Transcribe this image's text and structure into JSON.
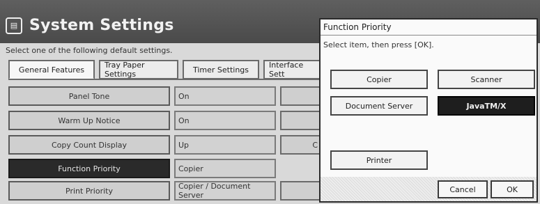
{
  "header": {
    "title": "System Settings",
    "icon": "settings-panel-icon"
  },
  "instruction": "Select one of the following default settings.",
  "tabs": [
    {
      "label": "General Features",
      "active": true
    },
    {
      "label": "Tray Paper Settings",
      "active": false
    },
    {
      "label": "Timer Settings",
      "active": false
    },
    {
      "label": "Interface Sett",
      "active": false
    }
  ],
  "settings": [
    {
      "label": "Panel Tone",
      "value": "On",
      "extra": "",
      "selected": false
    },
    {
      "label": "Warm Up Notice",
      "value": "On",
      "extra": "",
      "selected": false
    },
    {
      "label": "Copy Count Display",
      "value": "Up",
      "extra": "C",
      "selected": false
    },
    {
      "label": "Function Priority",
      "value": "Copier",
      "extra": "",
      "selected": true
    },
    {
      "label": "Print Priority",
      "value": "Copier / Document Server",
      "extra": "",
      "selected": false
    }
  ],
  "dialog": {
    "title": "Function Priority",
    "instruction": "Select item, then press [OK].",
    "options": [
      {
        "label": "Copier",
        "selected": false
      },
      {
        "label": "Scanner",
        "selected": false
      },
      {
        "label": "Document Server",
        "selected": false
      },
      {
        "label": "JavaTM/X",
        "selected": true
      },
      {
        "label": "Printer",
        "selected": false
      }
    ],
    "cancel_label": "Cancel",
    "ok_label": "OK"
  }
}
